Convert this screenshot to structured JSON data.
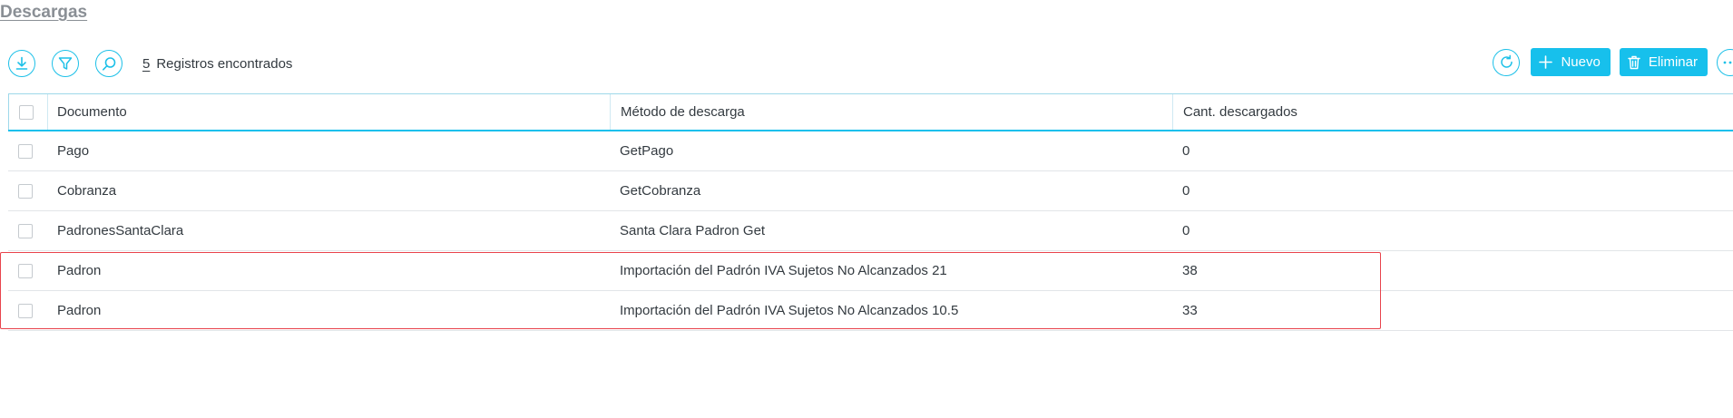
{
  "page": {
    "title": "Descargas"
  },
  "toolbar": {
    "download_icon": "download-icon",
    "filter_icon": "filter-icon",
    "search_icon": "search-icon",
    "record_count": "5",
    "record_label": "Registros encontrados",
    "refresh_icon": "refresh-icon",
    "new_label": "Nuevo",
    "delete_label": "Eliminar",
    "more_icon": "more-icon"
  },
  "table": {
    "columns": [
      "Documento",
      "Método de descarga",
      "Cant. descargados"
    ],
    "rows": [
      {
        "documento": "Pago",
        "metodo": "GetPago",
        "cantidad": "0"
      },
      {
        "documento": "Cobranza",
        "metodo": "GetCobranza",
        "cantidad": "0"
      },
      {
        "documento": "PadronesSantaClara",
        "metodo": "Santa Clara Padron Get",
        "cantidad": "0"
      },
      {
        "documento": "Padron",
        "metodo": "Importación del Padrón IVA Sujetos No Alcanzados 21",
        "cantidad": "38"
      },
      {
        "documento": "Padron",
        "metodo": "Importación del Padrón IVA Sujetos No Alcanzados 10.5",
        "cantidad": "33"
      }
    ]
  },
  "colors": {
    "accent": "#17c0ec",
    "highlight": "#e8434c",
    "title": "#8a8f95"
  }
}
